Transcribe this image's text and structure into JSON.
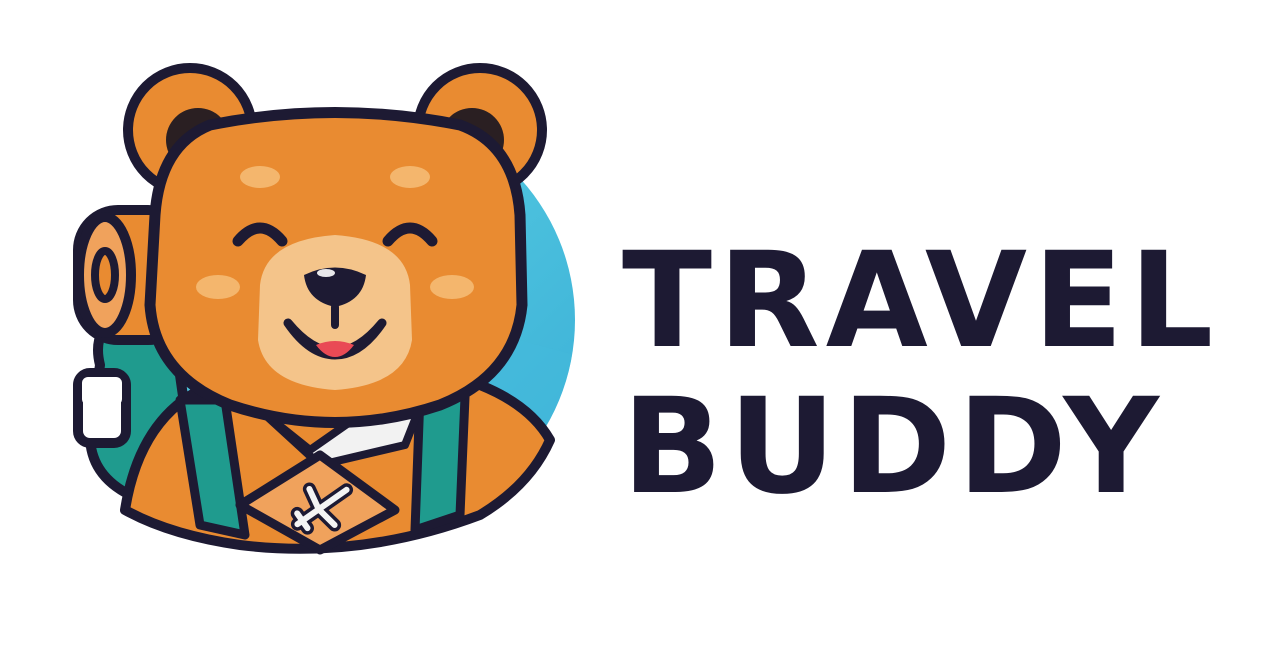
{
  "brand": {
    "line1": "TRAVEL",
    "line2": "BUDDY"
  },
  "mascot": {
    "icon": "bear-backpacker-icon",
    "badge_icon": "airplane-icon"
  },
  "colors": {
    "ink": "#1d1a33",
    "fur": "#e98b31",
    "fur_light": "#f4c48a",
    "ear_inner": "#2a1f22",
    "cheek": "#f0a25c",
    "sky_circle": "#4ec7df",
    "backpack": "#1f9b8e",
    "tongue": "#e94a55",
    "background": "#ffffff"
  }
}
